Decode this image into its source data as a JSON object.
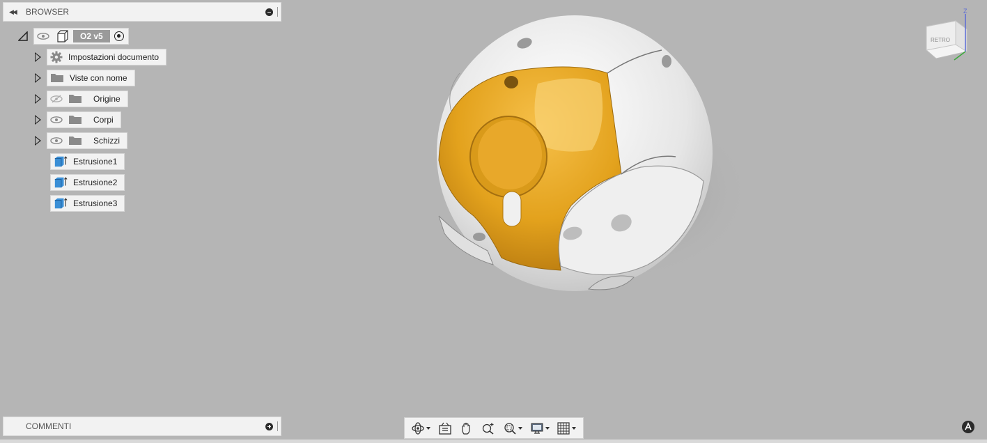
{
  "browser": {
    "title": "BROWSER",
    "root": {
      "name": "O2 v5"
    },
    "items": [
      {
        "label": "Impostazioni documento",
        "icon": "gear-icon"
      },
      {
        "label": "Viste con nome",
        "icon": "folder-icon"
      },
      {
        "label": "Origine",
        "icon": "folder-icon",
        "visibility": "hidden"
      },
      {
        "label": "Corpi",
        "icon": "folder-icon",
        "visibility": "visible"
      },
      {
        "label": "Schizzi",
        "icon": "folder-icon",
        "visibility": "visible"
      },
      {
        "label": "Estrusione1",
        "icon": "extrude-icon"
      },
      {
        "label": "Estrusione2",
        "icon": "extrude-icon"
      },
      {
        "label": "Estrusione3",
        "icon": "extrude-icon"
      }
    ]
  },
  "comments": {
    "title": "COMMENTI"
  },
  "viewcube": {
    "face_label": "RETRO",
    "axis_label": "Z"
  },
  "toolbar": {
    "tools": [
      "orbit-icon",
      "look-at-icon",
      "pan-icon",
      "zoom-icon",
      "fit-icon",
      "display-settings-icon",
      "grid-icon"
    ]
  },
  "colors": {
    "background": "#b5b5b5",
    "panel": "#f2f2f2",
    "selection_orange": "#e8a41c",
    "model_white": "#ececec"
  }
}
